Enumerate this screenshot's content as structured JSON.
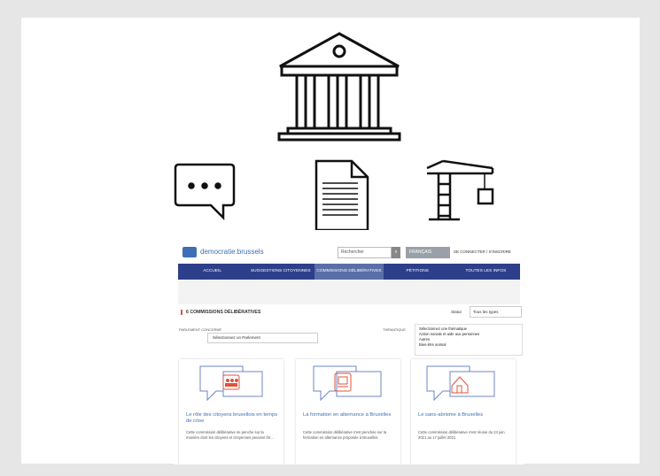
{
  "icons": [
    "government-building-icon",
    "chat-bubble-icon",
    "document-icon",
    "construction-crane-icon"
  ],
  "site": {
    "logo_text": "democratie.brussels",
    "search_placeholder": "Rechercher",
    "language": "FRANÇAIS",
    "login": "SE CONNECTER / S'INSCRIRE"
  },
  "nav": [
    "ACCUEIL",
    "SUGGESTIONS CITOYENNES",
    "COMMISSIONS DÉLIBÉRATIVES",
    "PÉTITIONS",
    "TOUTES LES INFOS"
  ],
  "section": {
    "title": "6 COMMISSIONS DÉLIBÉRATIVES",
    "statut_label": "Statut",
    "statut_value": "Tous les types",
    "parliament_label": "PARLEMENT CONCERNÉ",
    "parliament_value": "Sélectionnez un Parlement",
    "theme_label": "THÉMATIQUE",
    "themes": [
      "Sélectionnez une thématique",
      "Action sociale et aide aux personnes",
      "Autres",
      "Bien-être animal"
    ]
  },
  "cards": [
    {
      "title": "Le rôle des citoyens bruxellois en temps de crise",
      "desc": "Cette commission délibérative se penche sur la manière dont les citoyens et citoyennes peuvent êtr..."
    },
    {
      "title": "La formation en alternance à Bruxelles",
      "desc": "Cette commission délibérative s'est penchée sur la formation en alternance proposée à Bruxelles"
    },
    {
      "title": "Le sans-abrisme à Bruxelles",
      "desc": "Cette commission délibérative s'est réunie du 24 juin 2021 au 17 juillet 2021"
    }
  ]
}
